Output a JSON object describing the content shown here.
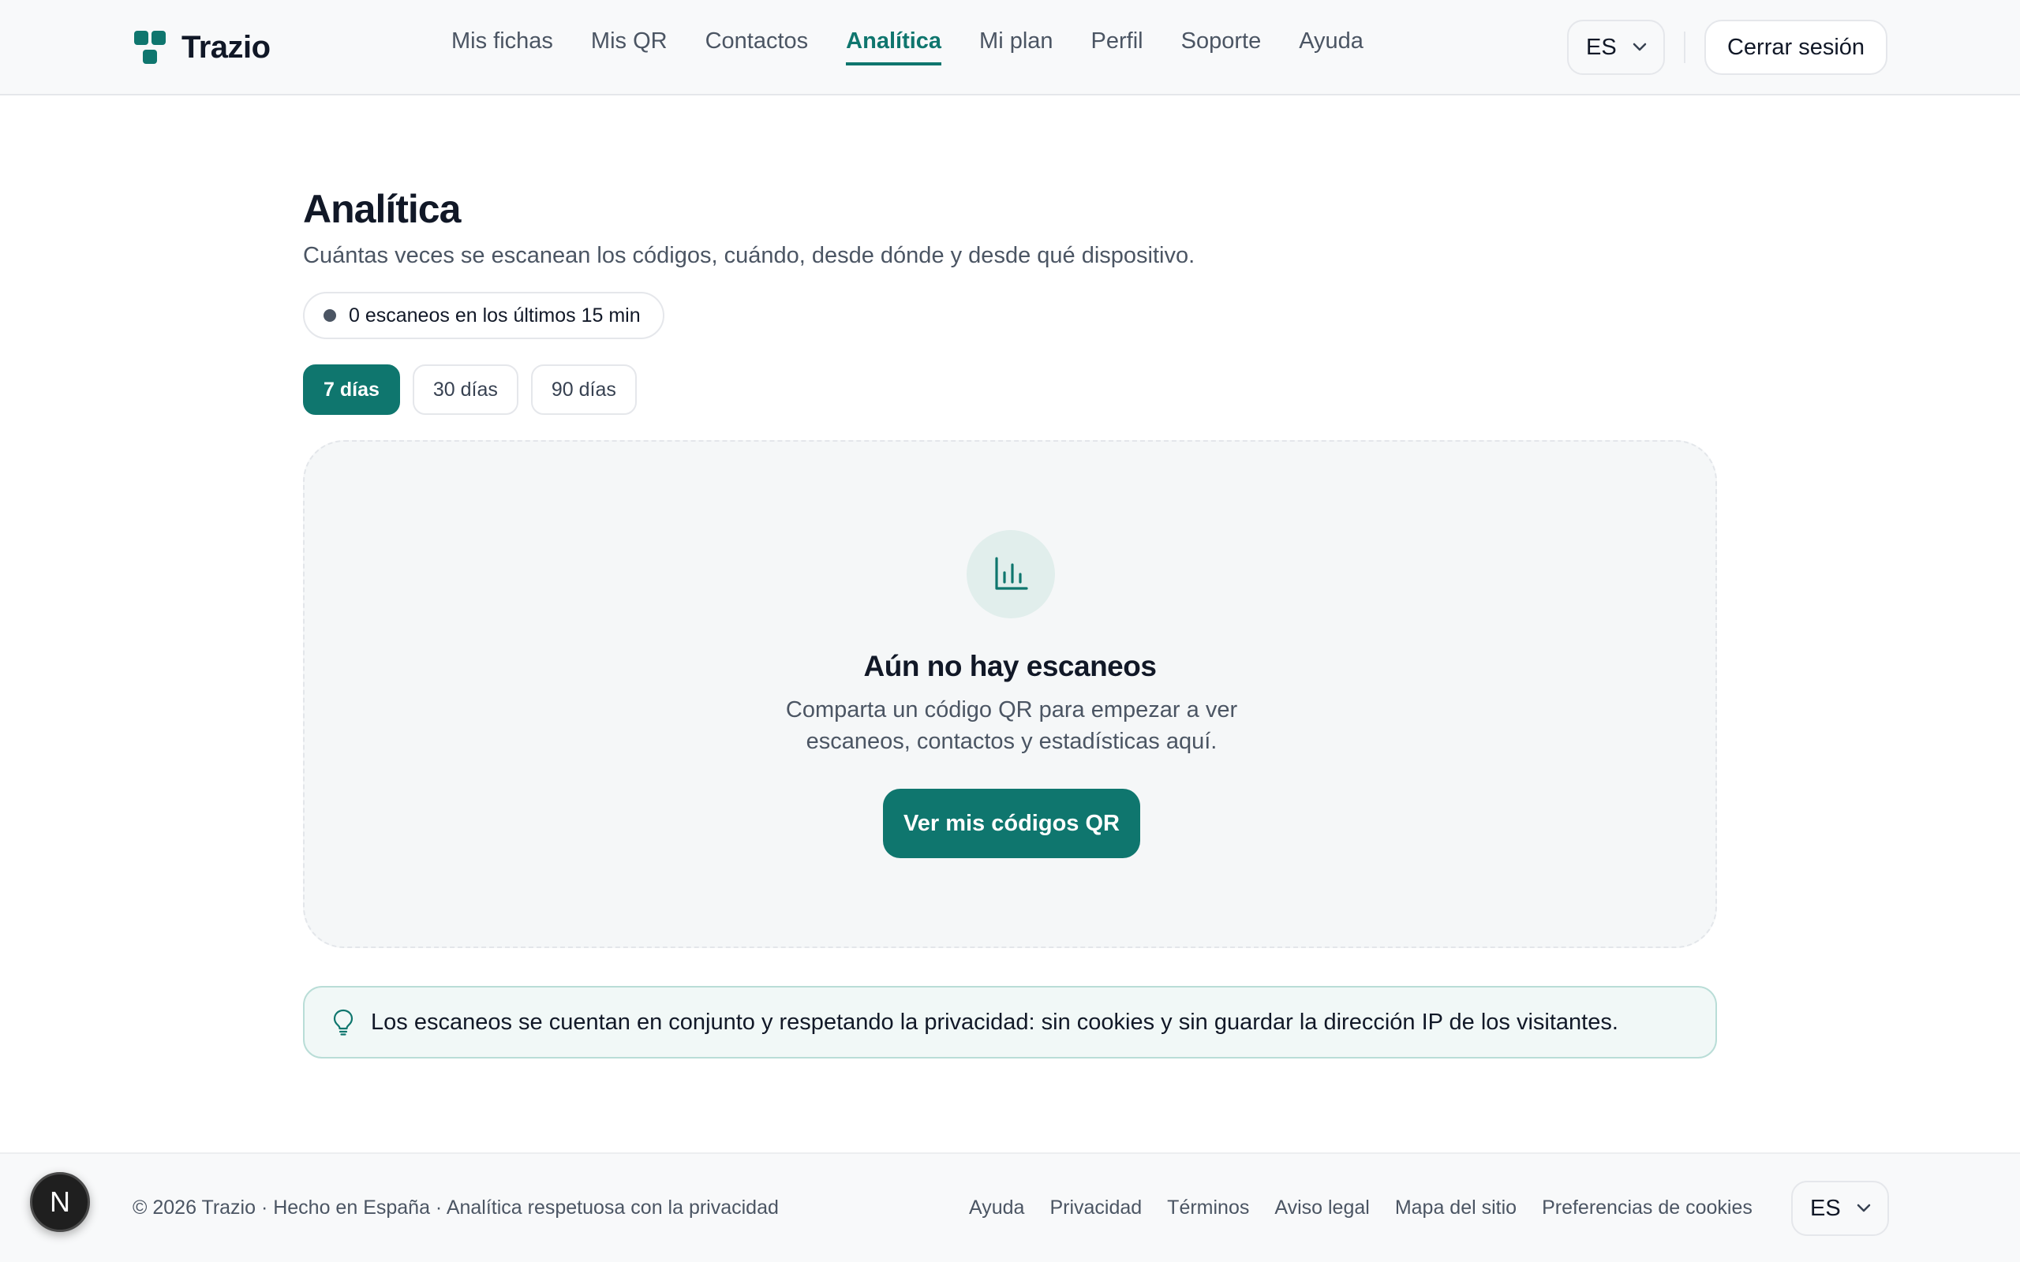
{
  "brand": {
    "name": "Trazio"
  },
  "nav": {
    "items": [
      {
        "label": "Mis fichas"
      },
      {
        "label": "Mis QR"
      },
      {
        "label": "Contactos"
      },
      {
        "label": "Analítica",
        "active": true
      },
      {
        "label": "Mi plan"
      },
      {
        "label": "Perfil"
      },
      {
        "label": "Soporte"
      },
      {
        "label": "Ayuda"
      }
    ]
  },
  "header": {
    "language": "ES",
    "logout_label": "Cerrar sesión"
  },
  "page": {
    "title": "Analítica",
    "subtitle": "Cuántas veces se escanean los códigos, cuándo, desde dónde y desde qué dispositivo.",
    "live_status": "0 escaneos en los últimos 15 min",
    "range_tabs": [
      {
        "label": "7 días",
        "active": true
      },
      {
        "label": "30 días"
      },
      {
        "label": "90 días"
      }
    ]
  },
  "empty_state": {
    "icon": "bar-chart-icon",
    "title": "Aún no hay escaneos",
    "text": "Comparta un código QR para empezar a ver escaneos, contactos y estadísticas aquí.",
    "cta_label": "Ver mis códigos QR"
  },
  "privacy_note": {
    "icon": "lightbulb-icon",
    "text": "Los escaneos se cuentan en conjunto y respetando la privacidad: sin cookies y sin guardar la dirección IP de los visitantes."
  },
  "footer": {
    "copyright": "© 2026 Trazio · Hecho en España · Analítica respetuosa con la privacidad",
    "links": [
      {
        "label": "Ayuda"
      },
      {
        "label": "Privacidad"
      },
      {
        "label": "Términos"
      },
      {
        "label": "Aviso legal"
      },
      {
        "label": "Mapa del sitio"
      },
      {
        "label": "Preferencias de cookies"
      }
    ],
    "language": "ES"
  },
  "dev_badge": {
    "label": "N"
  },
  "colors": {
    "accent": "#0f766e",
    "accent_soft": "#e1eeec",
    "text": "#111827",
    "muted": "#4b5563",
    "border": "#e5e7eb"
  }
}
